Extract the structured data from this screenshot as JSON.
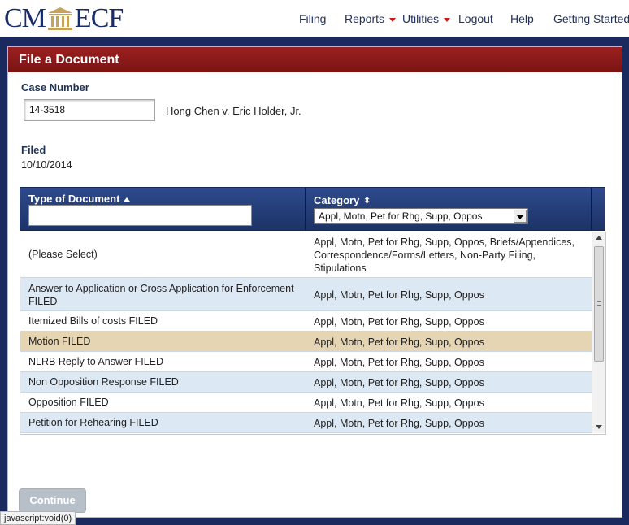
{
  "brand": {
    "left": "CM",
    "right": "ECF",
    "icon": "courthouse-icon"
  },
  "nav": [
    {
      "label": "Filing",
      "has_menu": false
    },
    {
      "label": "Reports",
      "has_menu": true
    },
    {
      "label": "Utilities",
      "has_menu": true
    },
    {
      "label": "Logout",
      "has_menu": false
    },
    {
      "label": "Help",
      "has_menu": false
    },
    {
      "label": "Getting Started",
      "has_menu": false
    }
  ],
  "panel": {
    "title": "File a Document"
  },
  "case": {
    "label": "Case Number",
    "value": "14-3518",
    "caption": "Hong Chen v. Eric Holder, Jr."
  },
  "filed": {
    "label": "Filed",
    "value": "10/10/2014"
  },
  "table": {
    "col1_header": "Type of Document",
    "col2_header": "Category",
    "filter_value": "",
    "category_selected": "Appl, Motn, Pet for Rhg, Supp, Oppos",
    "rows": [
      {
        "type": "(Please Select)",
        "category": "Appl, Motn, Pet for Rhg, Supp, Oppos, Briefs/Appendices, Correspondence/Forms/Letters, Non-Party Filing, Stipulations"
      },
      {
        "type": "Answer to Application or Cross Application for Enforcement FILED",
        "category": "Appl, Motn, Pet for Rhg, Supp, Oppos"
      },
      {
        "type": "Itemized Bills of costs FILED",
        "category": "Appl, Motn, Pet for Rhg, Supp, Oppos"
      },
      {
        "type": "Motion FILED",
        "category": "Appl, Motn, Pet for Rhg, Supp, Oppos",
        "selected": true
      },
      {
        "type": "NLRB Reply to Answer FILED",
        "category": "Appl, Motn, Pet for Rhg, Supp, Oppos"
      },
      {
        "type": "Non Opposition Response FILED",
        "category": "Appl, Motn, Pet for Rhg, Supp, Oppos"
      },
      {
        "type": "Opposition FILED",
        "category": "Appl, Motn, Pet for Rhg, Supp, Oppos"
      },
      {
        "type": "Petition for Rehearing FILED",
        "category": "Appl, Motn, Pet for Rhg, Supp, Oppos"
      }
    ]
  },
  "actions": {
    "continue_label": "Continue"
  },
  "status_bar": "javascript:void(0)",
  "colors": {
    "header_red": "#8b1a1a",
    "navy": "#1a2a5e",
    "row_alt": "#dde8f5",
    "row_selected": "#e6d5b3"
  }
}
